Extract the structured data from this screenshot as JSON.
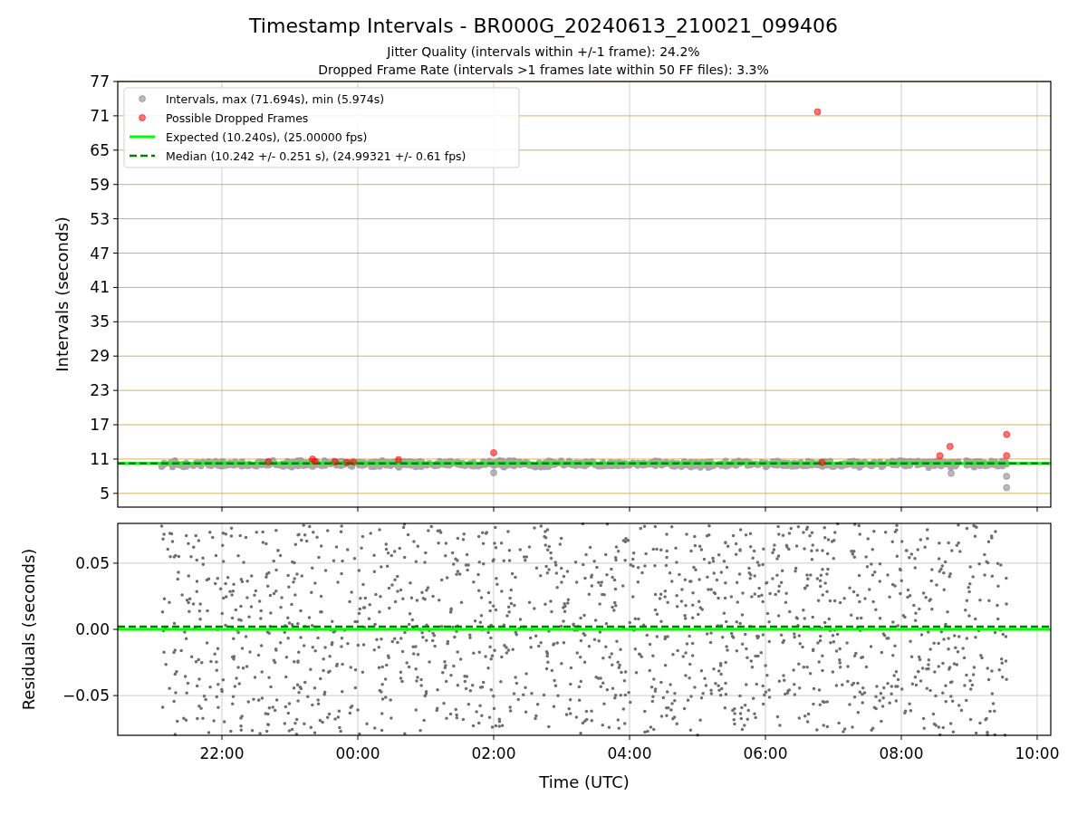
{
  "figure": {
    "title": "Timestamp Intervals - BR000G_20240613_210021_099406",
    "subtitles": [
      "Jitter Quality (intervals within +/-1 frame): 24.2%",
      "Dropped Frame Rate (intervals >1 frames late within 50 FF files): 3.3%"
    ]
  },
  "panels": [
    {
      "chart_data": {
        "type": "scatter",
        "ylabel": "Intervals (seconds)",
        "xlim": [
          "2024-06-13T20:28",
          "2024-06-14T10:12"
        ],
        "ylim": [
          2.6,
          77
        ],
        "grid": true,
        "legend": true,
        "yticks": [
          {
            "value": 5,
            "label": "5"
          },
          {
            "value": 11,
            "label": "11"
          },
          {
            "value": 17,
            "label": "17"
          },
          {
            "value": 23,
            "label": "23"
          },
          {
            "value": 29,
            "label": "29"
          },
          {
            "value": 35,
            "label": "35"
          },
          {
            "value": 41,
            "label": "41"
          },
          {
            "value": 47,
            "label": "47"
          },
          {
            "value": 53,
            "label": "53"
          },
          {
            "value": 59,
            "label": "59"
          },
          {
            "value": 65,
            "label": "65"
          },
          {
            "value": 71,
            "label": "71"
          },
          {
            "value": 77,
            "label": "77"
          }
        ],
        "series": [
          {
            "name": "Intervals, max (71.694s), min (5.974s)",
            "color": "#808080",
            "x": [
              "2024-06-14T09:33",
              "2024-06-14T09:33",
              "2024-06-14T02:00",
              "2024-06-14T08:44"
            ],
            "values": [
              6.0,
              8.0,
              8.6,
              8.5
            ]
          },
          {
            "name": "Possible Dropped Frames",
            "color": "#ff0000",
            "x": [
              "2024-06-13T22:41",
              "2024-06-13T23:20",
              "2024-06-13T23:22",
              "2024-06-13T23:40",
              "2024-06-13T23:50",
              "2024-06-13T23:56",
              "2024-06-14T00:36",
              "2024-06-14T02:00",
              "2024-06-14T06:46",
              "2024-06-14T06:50",
              "2024-06-14T08:34",
              "2024-06-14T08:43",
              "2024-06-14T09:33",
              "2024-06-14T09:33"
            ],
            "values": [
              10.5,
              11.0,
              10.6,
              10.5,
              10.4,
              10.5,
              10.9,
              12.1,
              71.7,
              10.4,
              11.6,
              13.2,
              15.3,
              11.6
            ]
          }
        ],
        "ref_lines": [
          {
            "axis": "y",
            "value": 10.24,
            "label": "Expected (10.240s), (25.00000 fps)",
            "color": "#00ff00"
          },
          {
            "axis": "y",
            "value": 10.242,
            "label": "Median (10.242 +/- 0.251 s), (24.99321 +/- 0.61 fps)",
            "color": "#008000"
          }
        ]
      }
    },
    {
      "chart_data": {
        "type": "scatter",
        "xlabel": "Time (UTC)",
        "ylabel": "Residuals (seconds)",
        "xlim": [
          "2024-06-13T20:28",
          "2024-06-14T10:12"
        ],
        "ylim": [
          -0.08,
          0.08
        ],
        "grid": true,
        "xticks": [
          {
            "value": "2024-06-13T22:00",
            "label": "22:00"
          },
          {
            "value": "2024-06-14T00:00",
            "label": "00:00"
          },
          {
            "value": "2024-06-14T02:00",
            "label": "02:00"
          },
          {
            "value": "2024-06-14T04:00",
            "label": "04:00"
          },
          {
            "value": "2024-06-14T06:00",
            "label": "06:00"
          },
          {
            "value": "2024-06-14T08:00",
            "label": "08:00"
          },
          {
            "value": "2024-06-14T10:00",
            "label": "10:00"
          }
        ],
        "yticks": [
          {
            "value": -0.05,
            "label": "−0.05"
          },
          {
            "value": 0,
            "label": "0.00"
          },
          {
            "value": 0.05,
            "label": "0.05"
          }
        ],
        "ref_lines": [
          {
            "axis": "y",
            "value": 0,
            "color": "#00ff00"
          },
          {
            "axis": "y",
            "value": 0.002,
            "color": "#008000"
          }
        ]
      }
    }
  ]
}
